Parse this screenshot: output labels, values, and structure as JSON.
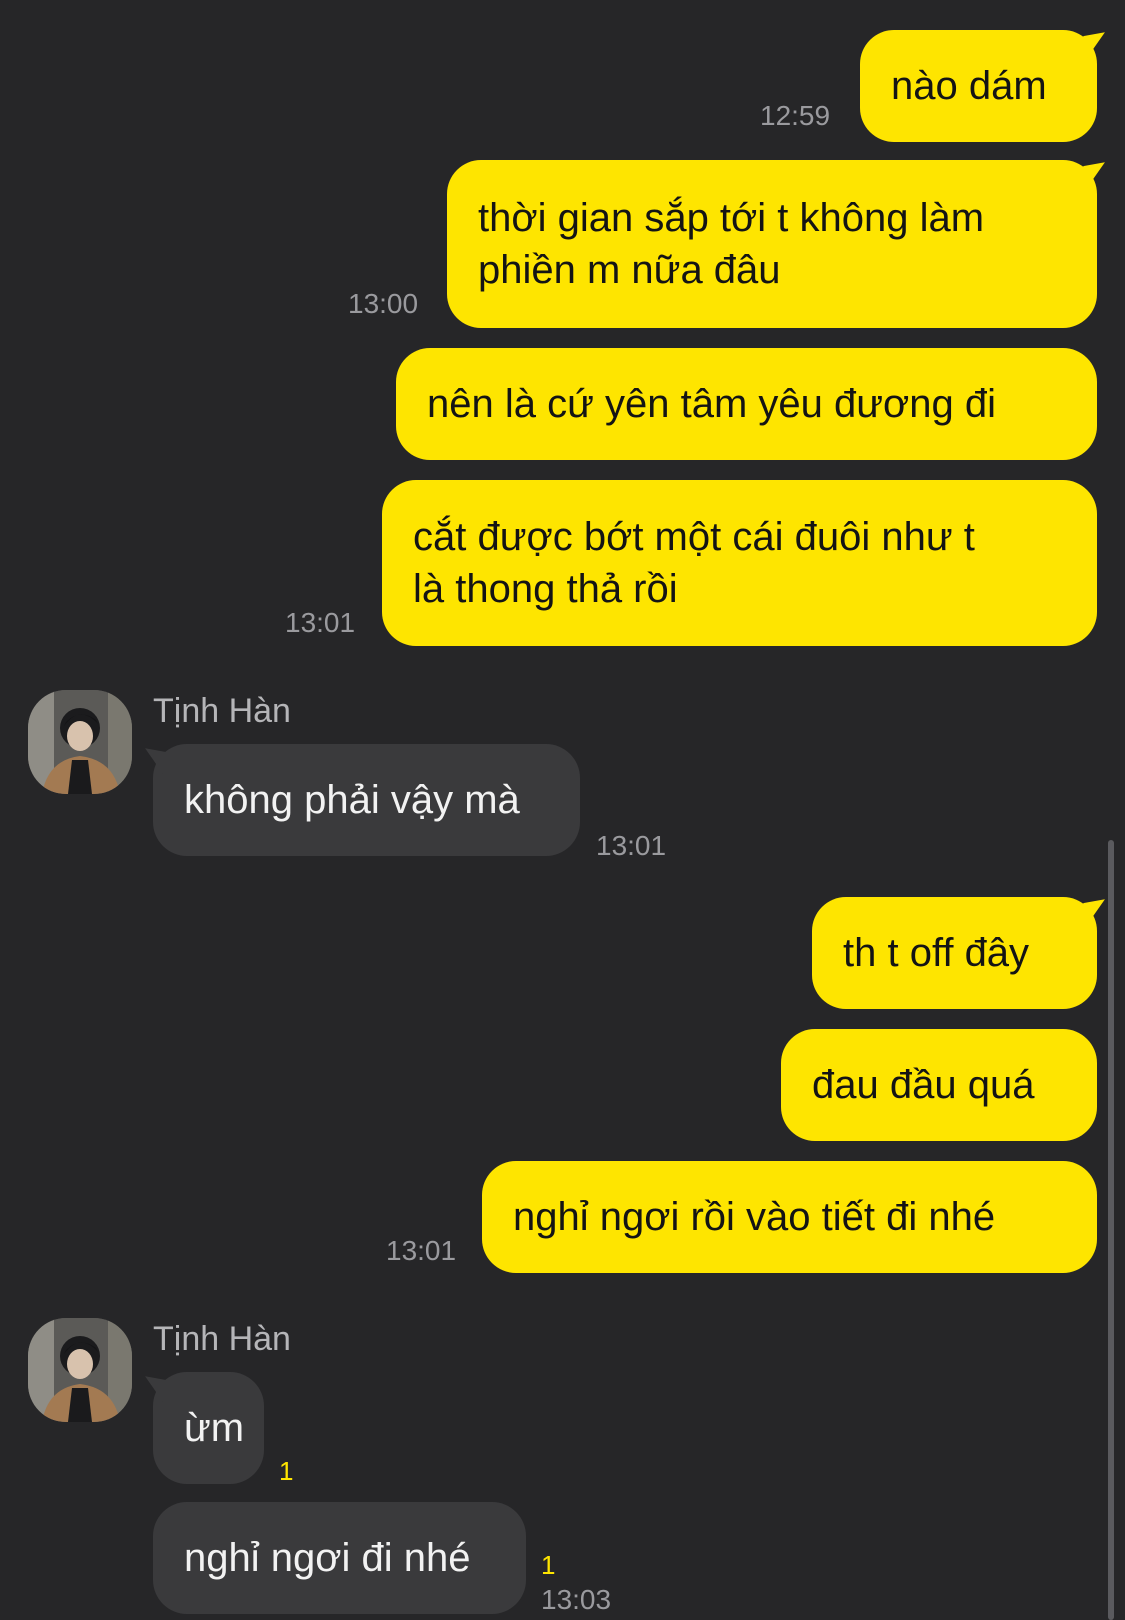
{
  "messages": {
    "m1": {
      "text": "nào dám",
      "time": "12:59"
    },
    "m2": {
      "text": "thời gian sắp tới t không làm\nphiền m nữa đâu",
      "time": "13:00"
    },
    "m3": {
      "text": "nên là cứ yên tâm yêu đương đi"
    },
    "m4": {
      "text": "cắt được bớt một cái đuôi như t\nlà thong thả rồi",
      "time": "13:01"
    },
    "t1": {
      "sender": "Tịnh Hàn",
      "text": "không phải vậy mà",
      "time": "13:01"
    },
    "m5": {
      "text": "th t off đây"
    },
    "m6": {
      "text": "đau đầu quá"
    },
    "m7": {
      "text": "nghỉ ngơi rồi vào tiết đi nhé",
      "time": "13:01"
    },
    "t2": {
      "sender": "Tịnh Hàn",
      "text": "ừm",
      "unread": "1"
    },
    "t3": {
      "text": "nghỉ ngơi đi nhé",
      "unread": "1",
      "time": "13:03"
    }
  },
  "colors": {
    "background": "#262628",
    "my_bubble": "#fee500",
    "their_bubble": "#3a3a3c",
    "unread_count": "#fee500"
  },
  "icons": {
    "avatar": "profile-photo"
  }
}
